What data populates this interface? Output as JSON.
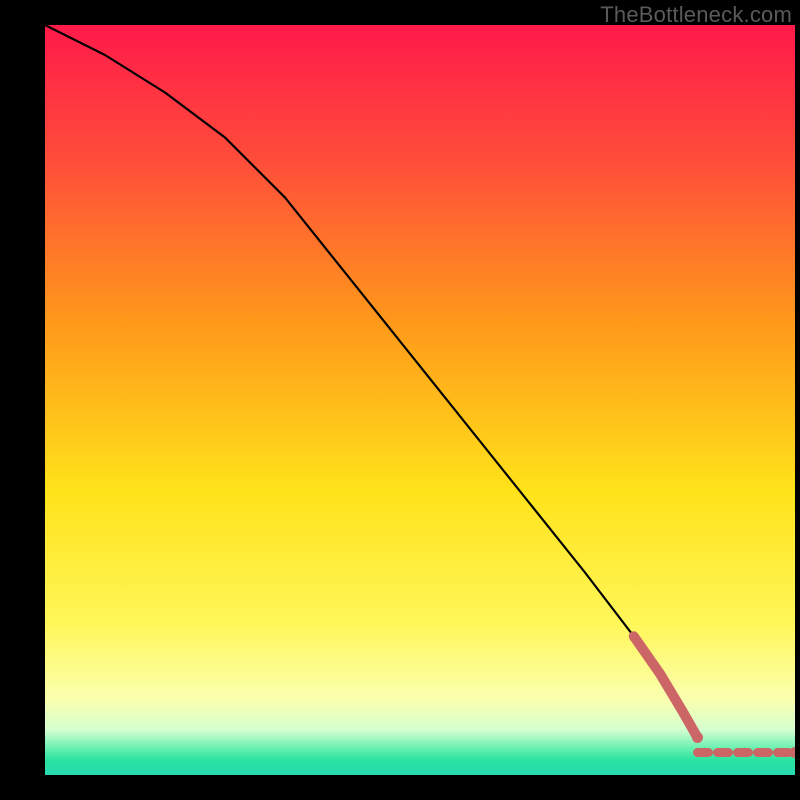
{
  "watermark": "TheBottleneck.com",
  "chart_data": {
    "type": "line",
    "title": "",
    "xlabel": "",
    "ylabel": "",
    "xlim": [
      0,
      100
    ],
    "ylim": [
      0,
      100
    ],
    "background_gradient": {
      "top": "#ff1744",
      "mid1": "#ff9100",
      "mid2": "#ffea00",
      "mid3": "#ffff8d",
      "bot1": "#00e676",
      "bot2": "#1de9b6"
    },
    "series": [
      {
        "name": "black-curve",
        "type": "line",
        "color": "#000000",
        "x": [
          0,
          8,
          16,
          24,
          28,
          32,
          40,
          48,
          56,
          64,
          72,
          78.5,
          82
        ],
        "y": [
          100,
          96,
          91,
          85,
          81,
          77,
          67,
          57,
          47,
          37,
          27,
          18.5,
          13.5
        ]
      },
      {
        "name": "thick-red-segment",
        "type": "line",
        "color": "#cc6666",
        "thick": true,
        "x": [
          78.5,
          82,
          85,
          87
        ],
        "y": [
          18.5,
          13.5,
          8.5,
          5
        ]
      },
      {
        "name": "dashed-red-tail",
        "type": "dashed",
        "color": "#cc6666",
        "x": [
          87,
          88.5,
          90,
          91.5,
          93,
          94.5,
          96,
          97.5,
          100
        ],
        "y": [
          3,
          3,
          3,
          3,
          3,
          3,
          3,
          3,
          3
        ]
      }
    ],
    "points": [
      {
        "x": 87,
        "y": 5,
        "color": "#cc6666"
      },
      {
        "x": 100,
        "y": 3,
        "color": "#cc6666"
      }
    ]
  }
}
